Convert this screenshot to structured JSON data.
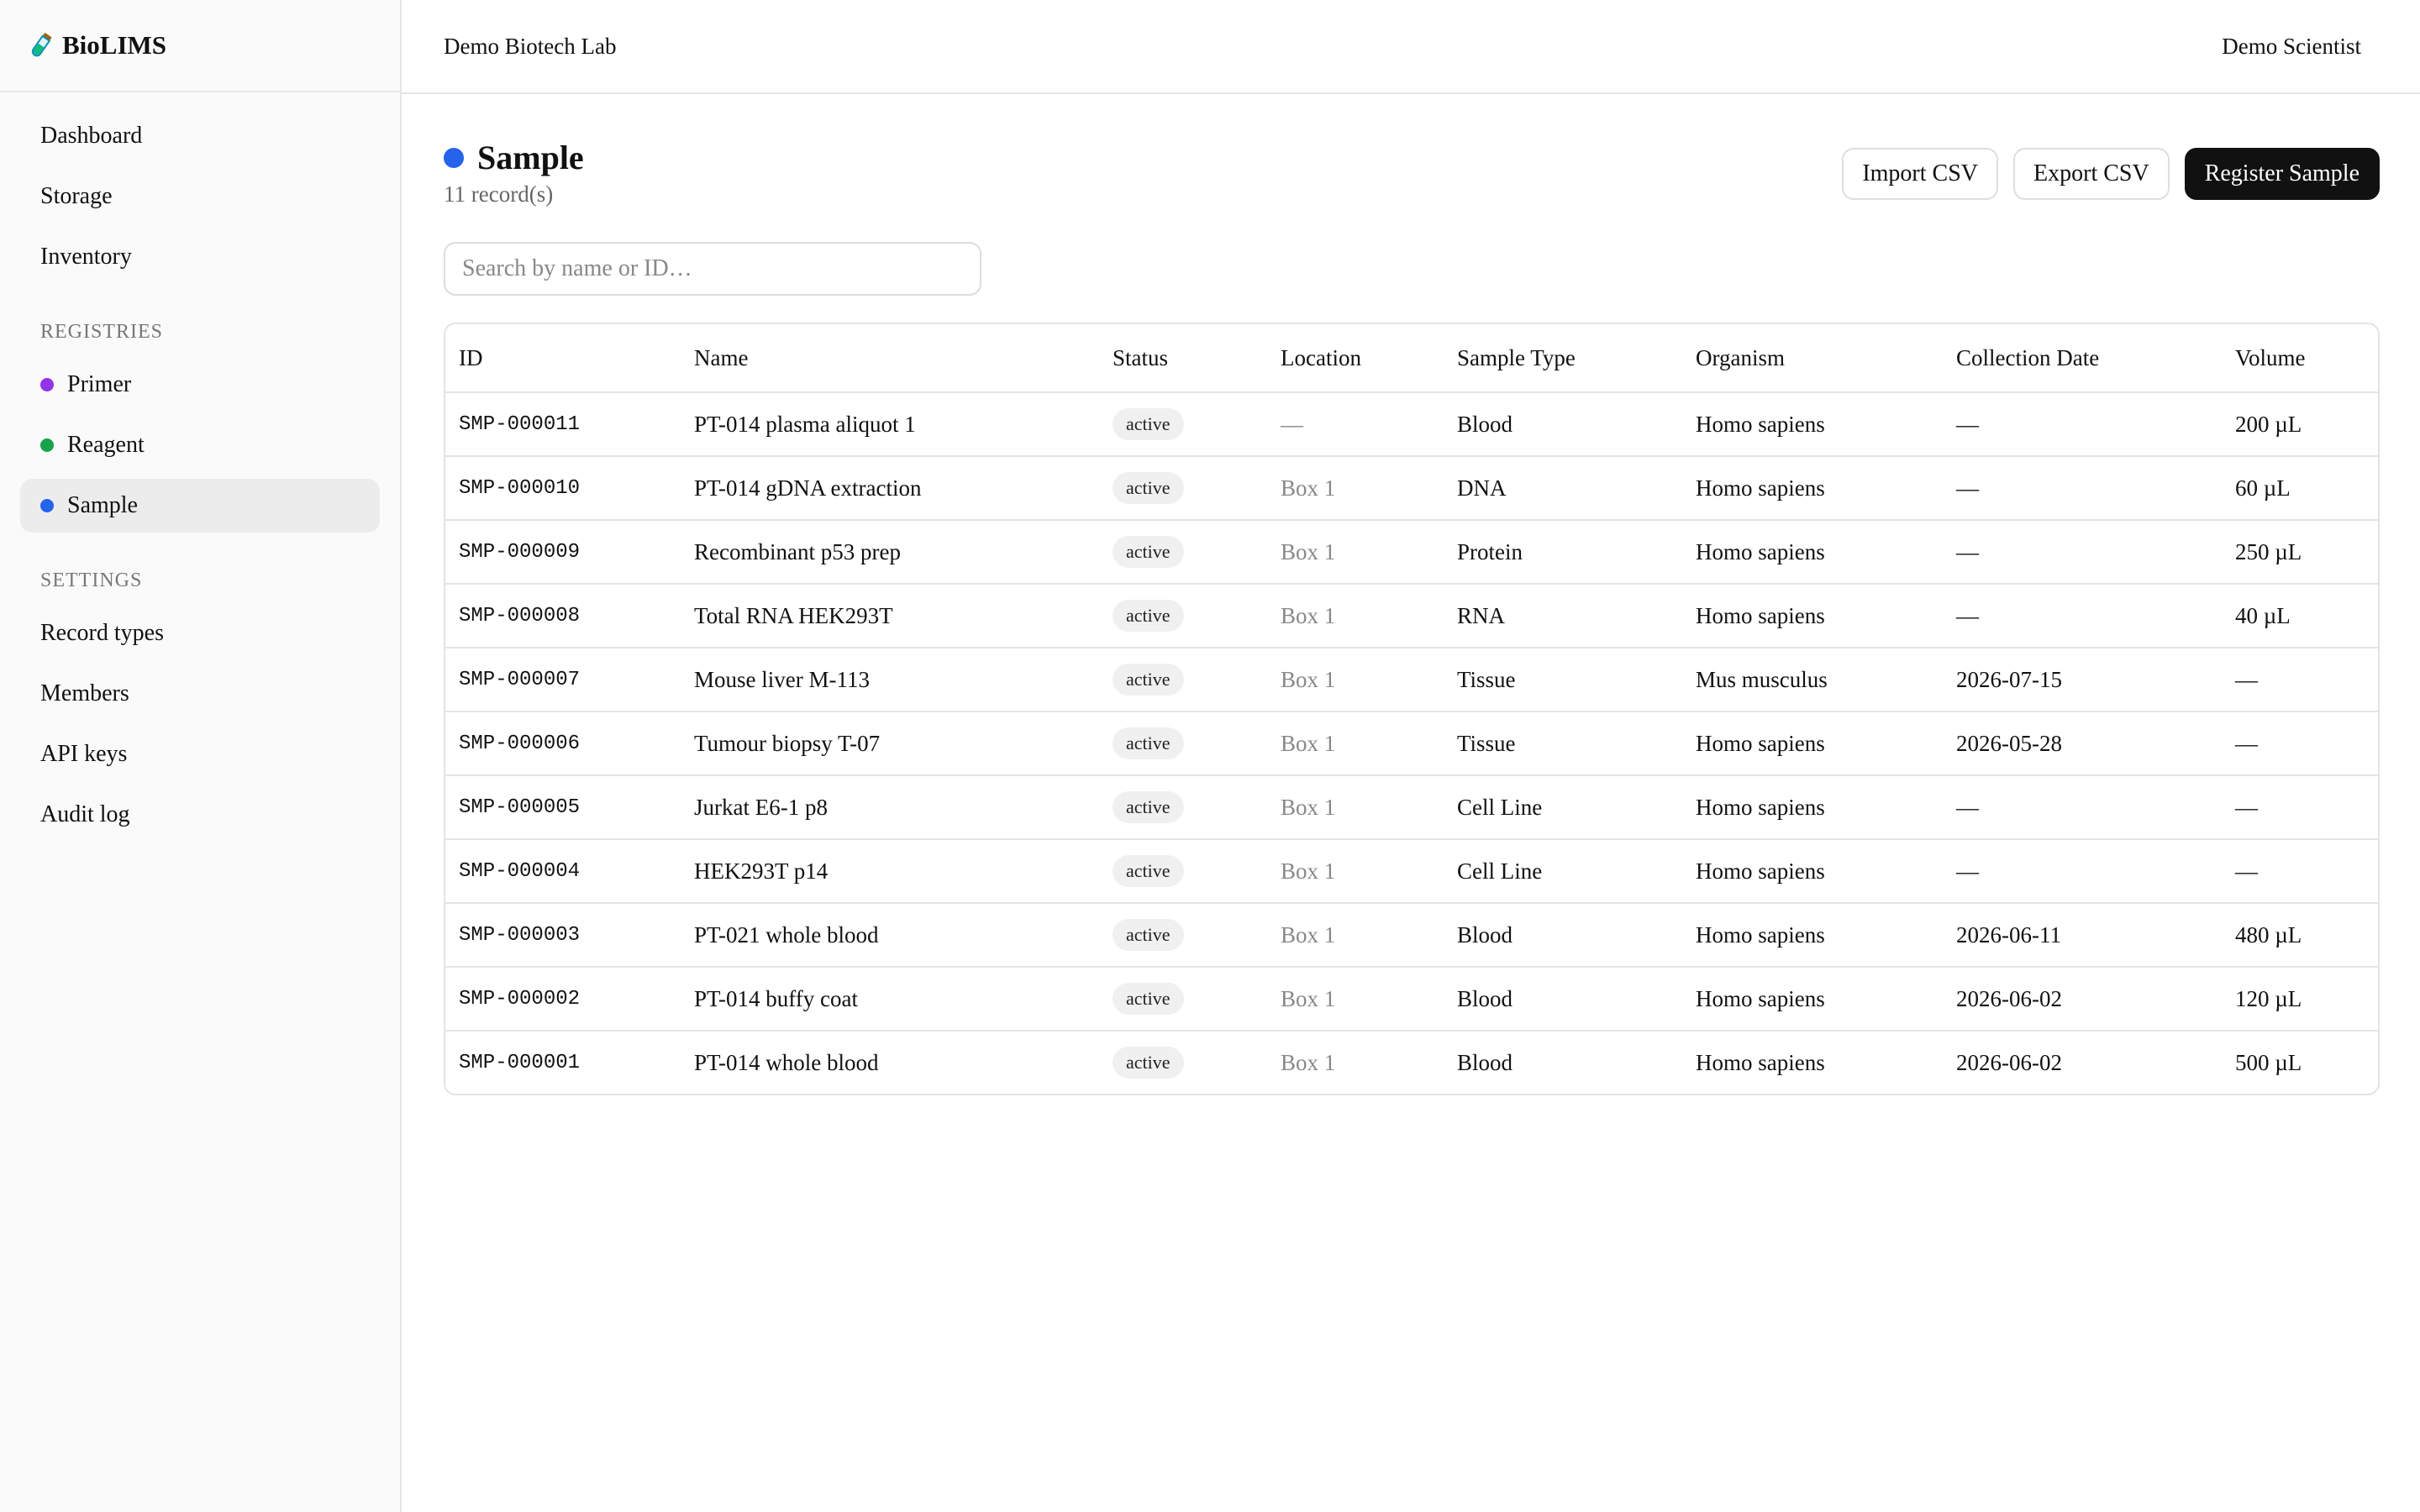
{
  "app": {
    "brand": "BioLIMS",
    "brand_icon": "flask-icon"
  },
  "header": {
    "org": "Demo Biotech Lab",
    "user": "Demo Scientist"
  },
  "sidebar": {
    "top_items": [
      {
        "label": "Dashboard"
      },
      {
        "label": "Storage"
      },
      {
        "label": "Inventory"
      }
    ],
    "registries_label": "REGISTRIES",
    "registries": [
      {
        "label": "Primer",
        "color": "#9333ea"
      },
      {
        "label": "Reagent",
        "color": "#16a34a"
      },
      {
        "label": "Sample",
        "color": "#2563eb",
        "active": true
      }
    ],
    "settings_label": "SETTINGS",
    "settings": [
      {
        "label": "Record types"
      },
      {
        "label": "Members"
      },
      {
        "label": "API keys"
      },
      {
        "label": "Audit log"
      }
    ]
  },
  "page": {
    "title": "Sample",
    "title_color": "#2563eb",
    "record_count": "11 record(s)",
    "import_label": "Import CSV",
    "export_label": "Export CSV",
    "register_label": "Register Sample",
    "search_placeholder": "Search by name or ID…"
  },
  "table": {
    "columns": [
      "ID",
      "Name",
      "Status",
      "Location",
      "Sample Type",
      "Organism",
      "Collection Date",
      "Volume"
    ],
    "rows": [
      [
        "SMP-000011",
        "PT-014 plasma aliquot 1",
        "active",
        "—",
        "Blood",
        "Homo sapiens",
        "—",
        "200 µL"
      ],
      [
        "SMP-000010",
        "PT-014 gDNA extraction",
        "active",
        "Box 1",
        "DNA",
        "Homo sapiens",
        "—",
        "60 µL"
      ],
      [
        "SMP-000009",
        "Recombinant p53 prep",
        "active",
        "Box 1",
        "Protein",
        "Homo sapiens",
        "—",
        "250 µL"
      ],
      [
        "SMP-000008",
        "Total RNA HEK293T",
        "active",
        "Box 1",
        "RNA",
        "Homo sapiens",
        "—",
        "40 µL"
      ],
      [
        "SMP-000007",
        "Mouse liver M-113",
        "active",
        "Box 1",
        "Tissue",
        "Mus musculus",
        "2026-07-15",
        "—"
      ],
      [
        "SMP-000006",
        "Tumour biopsy T-07",
        "active",
        "Box 1",
        "Tissue",
        "Homo sapiens",
        "2026-05-28",
        "—"
      ],
      [
        "SMP-000005",
        "Jurkat E6-1 p8",
        "active",
        "Box 1",
        "Cell Line",
        "Homo sapiens",
        "—",
        "—"
      ],
      [
        "SMP-000004",
        "HEK293T p14",
        "active",
        "Box 1",
        "Cell Line",
        "Homo sapiens",
        "—",
        "—"
      ],
      [
        "SMP-000003",
        "PT-021 whole blood",
        "active",
        "Box 1",
        "Blood",
        "Homo sapiens",
        "2026-06-11",
        "480 µL"
      ],
      [
        "SMP-000002",
        "PT-014 buffy coat",
        "active",
        "Box 1",
        "Blood",
        "Homo sapiens",
        "2026-06-02",
        "120 µL"
      ],
      [
        "SMP-000001",
        "PT-014 whole blood",
        "active",
        "Box 1",
        "Blood",
        "Homo sapiens",
        "2026-06-02",
        "500 µL"
      ]
    ]
  }
}
